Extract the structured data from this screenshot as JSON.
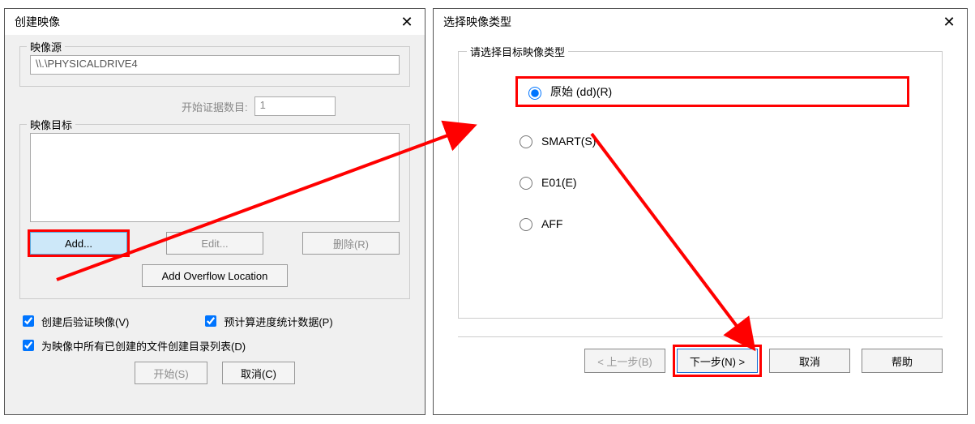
{
  "left_dialog": {
    "title": "创建映像",
    "source": {
      "legend": "映像源",
      "value": "\\\\.\\PHYSICALDRIVE4"
    },
    "start_evidence": {
      "label": "开始证据数目:",
      "value": "1"
    },
    "target": {
      "legend": "映像目标",
      "buttons": {
        "add": "Add...",
        "edit": "Edit...",
        "remove": "删除(R)"
      },
      "overflow": "Add Overflow Location"
    },
    "checks": {
      "verify": "创建后验证映像(V)",
      "precalc": "预计算进度统计数据(P)",
      "listing": "为映像中所有已创建的文件创建目录列表(D)"
    },
    "bottom": {
      "start": "开始(S)",
      "cancel": "取消(C)"
    }
  },
  "right_dialog": {
    "title": "选择映像类型",
    "group_legend": "请选择目标映像类型",
    "options": {
      "raw": "原始 (dd)(R)",
      "smart": "SMART(S)",
      "e01": "E01(E)",
      "aff": "AFF"
    },
    "wizard": {
      "back": "< 上一步(B)",
      "next": "下一步(N) >",
      "cancel": "取消",
      "help": "帮助"
    }
  }
}
